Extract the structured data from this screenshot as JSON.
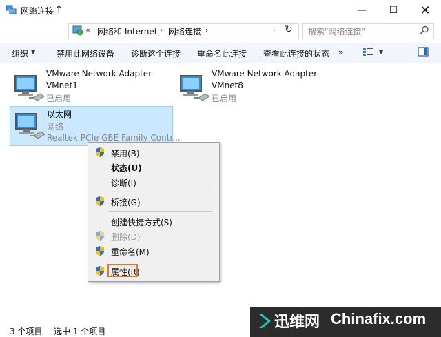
{
  "window": {
    "title": "网络连接",
    "controls": {
      "minimize": "—",
      "maximize": "☐",
      "close": "✕"
    }
  },
  "nav": {
    "back": "←",
    "forward": "→",
    "recent": "⌄",
    "up": "↑",
    "chevron": "«",
    "breadcrumb": [
      "网络和 Internet",
      "网络连接"
    ],
    "separator": "›",
    "refresh": "↻",
    "dropdown": "⌄",
    "search_placeholder": "搜索\"网络连接\""
  },
  "toolbar": {
    "organize": "组织",
    "organize_arrow": "▼",
    "disable": "禁用此网络设备",
    "diagnose": "诊断这个连接",
    "rename": "重命名此连接",
    "view_status": "查看此连接的状态",
    "more": "»",
    "view_arrow": "▼"
  },
  "adapters": [
    {
      "name": "VMware Network Adapter",
      "sub": "VMnet1",
      "status": "已启用"
    },
    {
      "name": "VMware Network Adapter",
      "sub": "VMnet8",
      "status": "已启用"
    },
    {
      "name": "以太网",
      "sub": "网络",
      "status": "Realtek PCIe GBE Family Contr...",
      "selected": true
    }
  ],
  "context_menu": {
    "disable": "禁用(B)",
    "status": "状态(U)",
    "diagnose": "诊断(I)",
    "bridge": "桥接(G)",
    "shortcut": "创建快捷方式(S)",
    "delete": "删除(D)",
    "rename": "重命名(M)",
    "properties": "属性(R)"
  },
  "statusbar": {
    "count": "3 个项目",
    "selected": "选中 1 个项目"
  },
  "watermark": {
    "cn": "迅维网",
    "en": "Chinafix.com"
  },
  "colors": {
    "selection_bg": "#cce8ff",
    "selection_border": "#99d1ff",
    "highlight_box": "#e07a2a",
    "toolbar_bg": "#f2f5fb"
  }
}
